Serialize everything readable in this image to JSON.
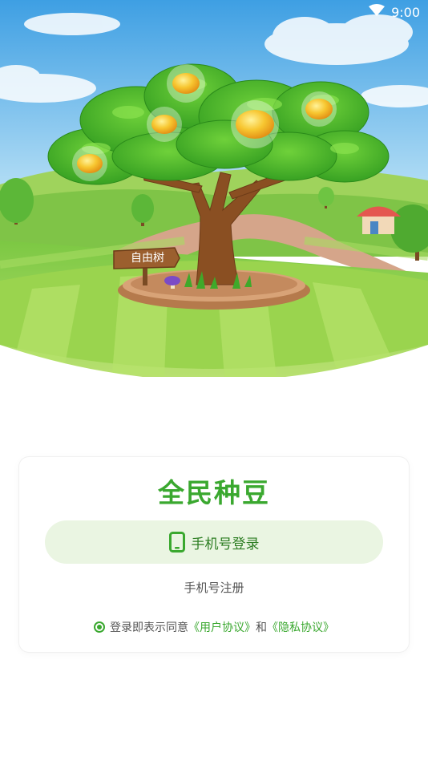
{
  "status_bar": {
    "time": "9:00",
    "icons": [
      "wifi-icon"
    ]
  },
  "hero": {
    "sign_text": "自由树"
  },
  "login_card": {
    "app_title": "全民种豆",
    "phone_login_label": "手机号登录",
    "phone_icon": "phone-icon",
    "register_label": "手机号注册",
    "agreement": {
      "prefix": "登录即表示同意",
      "user_agreement": "《用户协议》",
      "conjunction": "和",
      "privacy_agreement": "《隐私协议》",
      "checked": true
    }
  },
  "colors": {
    "brand_green": "#3aa82f",
    "button_bg": "#eaf5e2",
    "sky": "#4aa6e4",
    "grass": "#8ed24a"
  }
}
